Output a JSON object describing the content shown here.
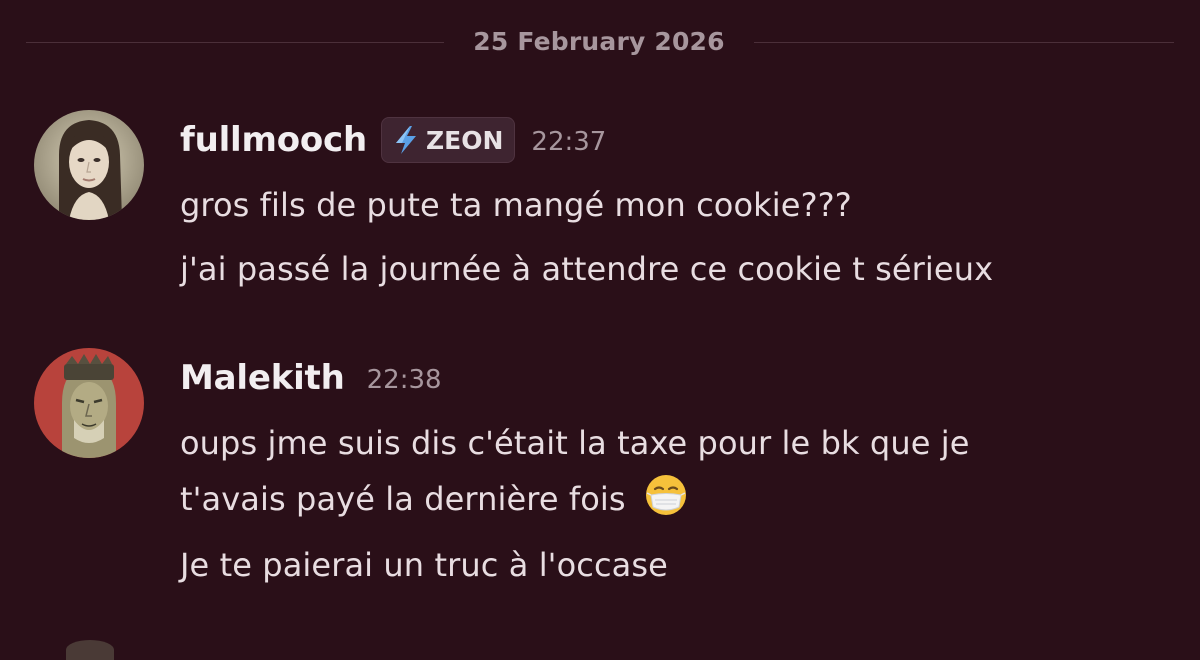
{
  "date_divider": "25 February 2026",
  "messages": [
    {
      "author": "fullmooch",
      "tag": "ZEON",
      "tag_icon": "lightning-bolt-icon",
      "time": "22:37",
      "lines": [
        "gros fils de pute ta mangé mon cookie???",
        "j'ai passé la journée à attendre ce cookie t sérieux"
      ]
    },
    {
      "author": "Malekith",
      "time": "22:38",
      "lines": [
        "oups jme suis dis c'était la taxe pour le bk que je",
        "t'avais payé la dernière fois",
        "Je te paierai un truc à l'occase"
      ],
      "emoji": "face-with-medical-mask"
    }
  ],
  "colors": {
    "background": "#2a0f18",
    "username": "#f2eef0",
    "timestamp": "#a7969d",
    "message_text": "#e8dde1",
    "tag_bolt": "#5aa0e6"
  }
}
